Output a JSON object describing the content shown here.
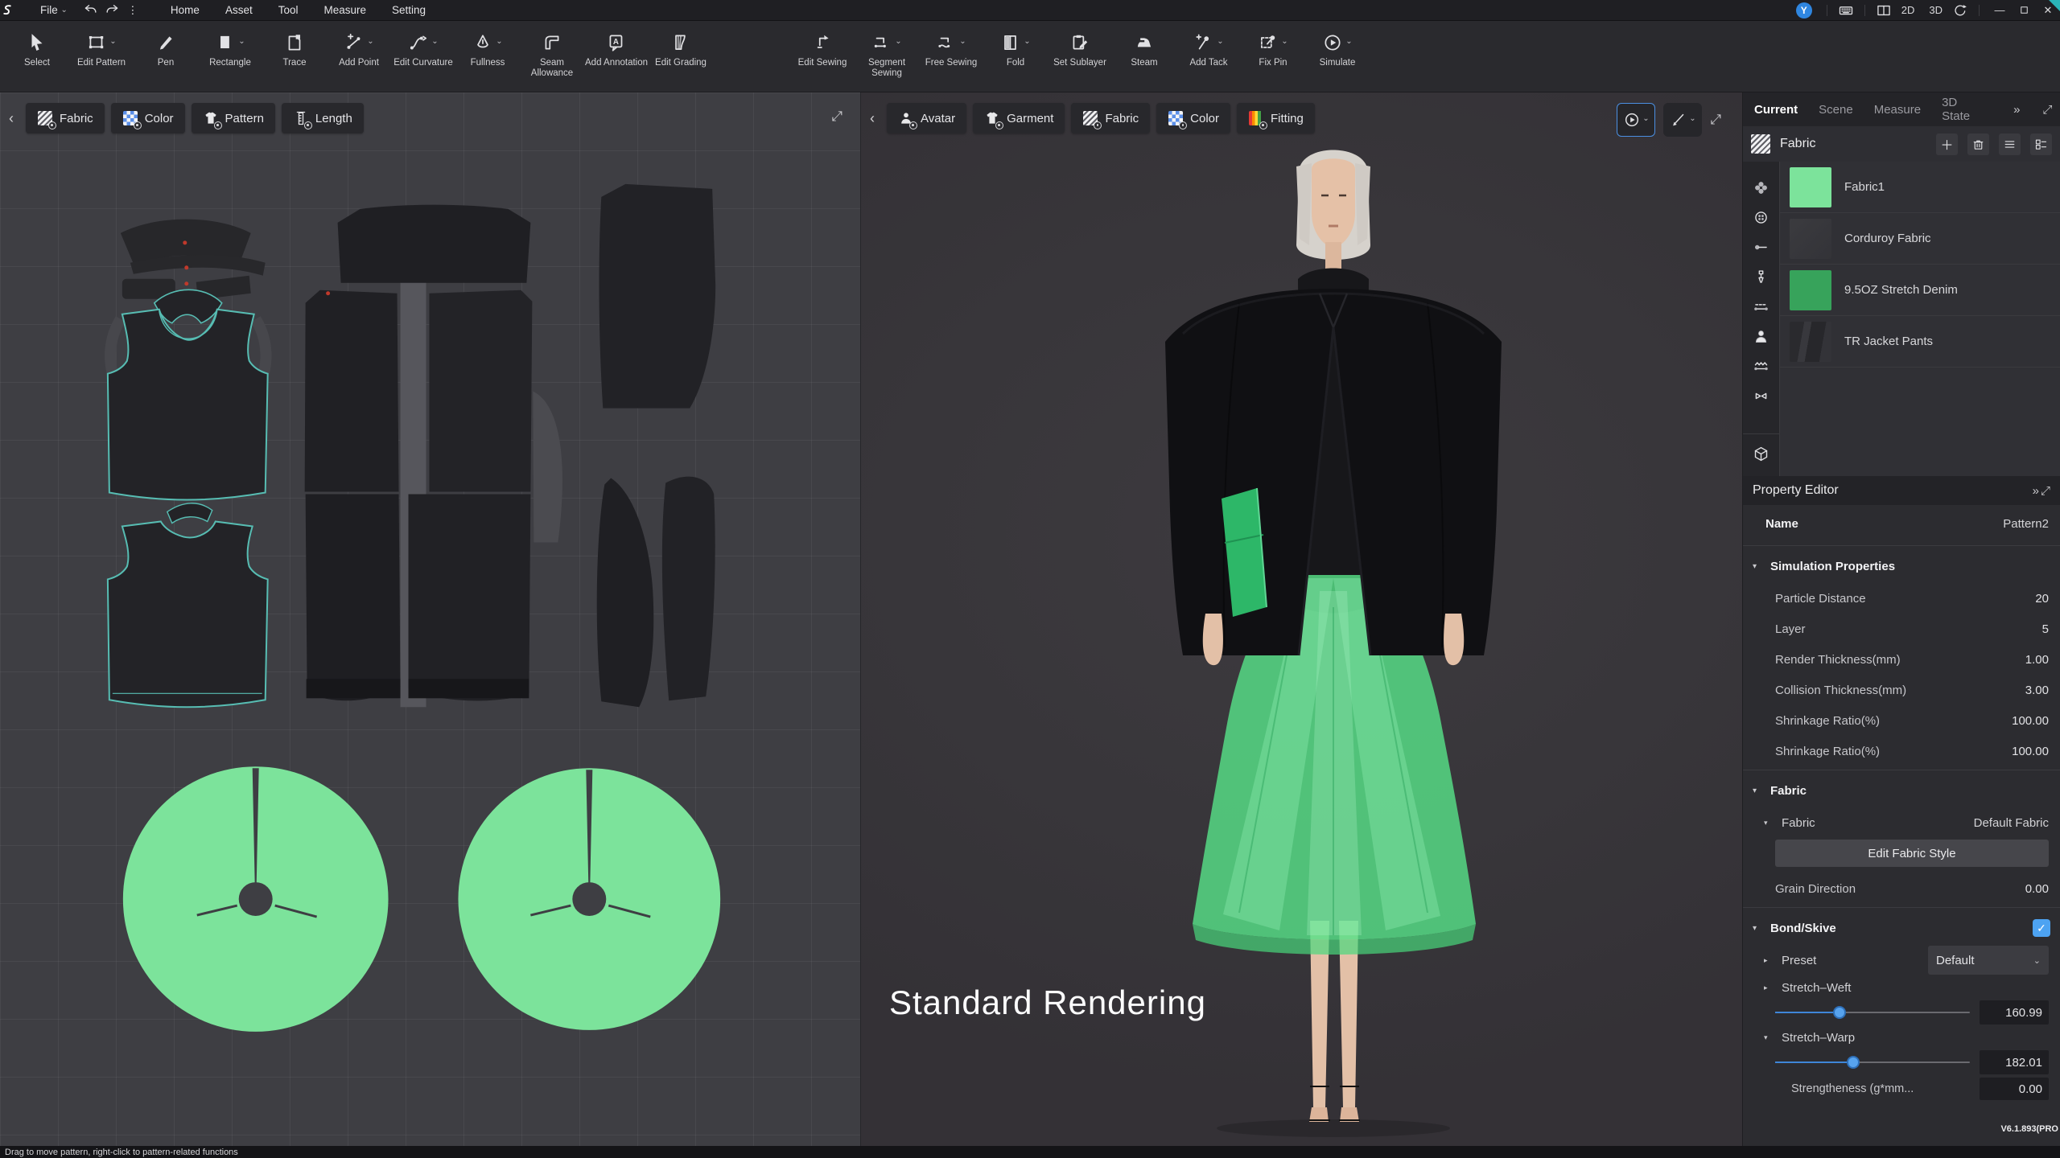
{
  "icons": {
    "caret_down": "⌄",
    "chevron_left": "‹",
    "collapse": "»",
    "expand": "⤢",
    "plus": "＋",
    "check": "✓",
    "minimize": "—",
    "close": "✕",
    "dots": "⋮",
    "tri_down": "▾",
    "tri_right": "▸",
    "label_2d": "2D",
    "label_3d": "3D"
  },
  "menu": {
    "file": "File",
    "items": [
      "Home",
      "Asset",
      "Tool",
      "Measure",
      "Setting"
    ],
    "profile_initial": "Y"
  },
  "toolbar": {
    "items": [
      {
        "label": "Select"
      },
      {
        "label": "Edit Pattern"
      },
      {
        "label": "Pen"
      },
      {
        "label": "Rectangle"
      },
      {
        "label": "Trace"
      },
      {
        "label": "Add Point"
      },
      {
        "label": "Edit Curvature"
      },
      {
        "label": "Fullness"
      },
      {
        "label": "Seam Allowance"
      },
      {
        "label": "Add Annotation"
      },
      {
        "label": "Edit Grading"
      },
      {
        "label": "Edit Sewing"
      },
      {
        "label": "Segment Sewing"
      },
      {
        "label": "Free Sewing"
      },
      {
        "label": "Fold"
      },
      {
        "label": "Set Sublayer"
      },
      {
        "label": "Steam"
      },
      {
        "label": "Add Tack"
      },
      {
        "label": "Fix Pin"
      },
      {
        "label": "Simulate"
      }
    ]
  },
  "panel2d": {
    "tabs": [
      {
        "label": "Fabric"
      },
      {
        "label": "Color"
      },
      {
        "label": "Pattern"
      },
      {
        "label": "Length"
      }
    ]
  },
  "panel3d": {
    "tabs": [
      {
        "label": "Avatar"
      },
      {
        "label": "Garment"
      },
      {
        "label": "Fabric"
      },
      {
        "label": "Color"
      },
      {
        "label": "Fitting"
      }
    ],
    "overlay_label": "Standard Rendering"
  },
  "right": {
    "tabs": [
      {
        "label": "Current"
      },
      {
        "label": "Scene"
      },
      {
        "label": "Measure"
      },
      {
        "label": "3D State"
      }
    ],
    "library": {
      "title": "Fabric",
      "items": [
        {
          "name": "Fabric1",
          "swatch": "#7ce39b"
        },
        {
          "name": "Corduroy Fabric",
          "swatch": "#38383c"
        },
        {
          "name": "9.5OZ Stretch Denim",
          "swatch": "#37a35b"
        },
        {
          "name": "TR Jacket Pants",
          "swatch": "#2c2c30"
        }
      ]
    },
    "property_editor": {
      "title": "Property Editor",
      "name_label": "Name",
      "name_value": "Pattern2",
      "simulation": {
        "title": "Simulation Properties",
        "rows": [
          {
            "label": "Particle Distance",
            "value": "20"
          },
          {
            "label": "Layer",
            "value": "5"
          },
          {
            "label": "Render Thickness(mm)",
            "value": "1.00"
          },
          {
            "label": "Collision Thickness(mm)",
            "value": "3.00"
          },
          {
            "label": "Shrinkage Ratio(%)",
            "value": "100.00"
          },
          {
            "label": "Shrinkage Ratio(%)",
            "value": "100.00"
          }
        ]
      },
      "fabric": {
        "title": "Fabric",
        "row_label": "Fabric",
        "row_value": "Default Fabric",
        "edit_button": "Edit Fabric Style",
        "grain_label": "Grain Direction",
        "grain_value": "0.00"
      },
      "bond": {
        "title": "Bond/Skive",
        "preset_label": "Preset",
        "preset_value": "Default",
        "weft_label": "Stretch–Weft",
        "weft_value": "160.99",
        "warp_label": "Stretch–Warp",
        "warp_value": "182.01",
        "strength_label": "Strengtheness (g*mm...",
        "strength_value": "0.00"
      }
    }
  },
  "status": {
    "hint": "Drag to move pattern, right-click to pattern-related functions",
    "version": "V6.1.893(PRO"
  },
  "colors": {
    "accent_blue": "#4b8fe2",
    "green_light": "#7ce39b",
    "green_mid": "#37a35b",
    "teal_outline": "#57bdb3",
    "skirt_green": "#57e087"
  }
}
